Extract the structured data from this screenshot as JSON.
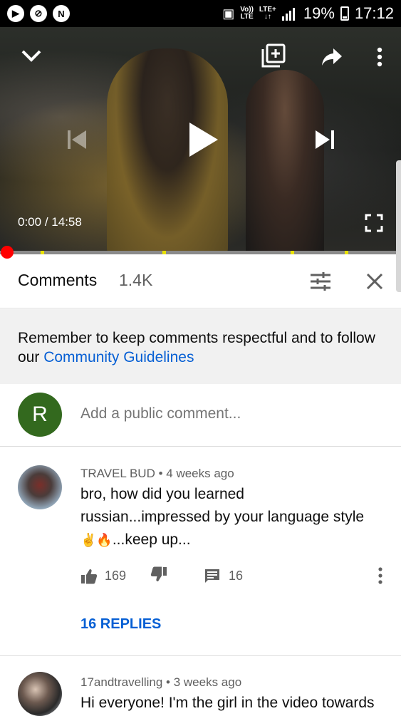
{
  "status_bar": {
    "network_top": "Vo))",
    "network_bottom": "LTE",
    "lte_top": "LTE+",
    "lte_bottom": "↓↑",
    "battery": "19%",
    "time": "17:12"
  },
  "player": {
    "time_current": "0:00",
    "time_separator": "/",
    "time_total": "14:58"
  },
  "comments_header": {
    "title": "Comments",
    "count": "1.4K"
  },
  "notice": {
    "text": "Remember to keep comments respectful and to follow our ",
    "link": "Community Guidelines"
  },
  "add_comment": {
    "avatar_letter": "R",
    "placeholder": "Add a public comment..."
  },
  "comments": [
    {
      "author": "TRAVEL BUD",
      "time": "4 weeks ago",
      "line1": "bro, how did you learned",
      "line2": "russian...impressed by your language style",
      "line3_emoji": "✌️🔥",
      "line3": "...keep up...",
      "likes": "169",
      "reply_count": "16",
      "replies_label": "16 REPLIES"
    },
    {
      "author": "17andtravelling",
      "time": "3 weeks ago",
      "line1": "Hi everyone! I'm the girl in the video towards"
    }
  ],
  "colors": {
    "accent_link": "#065fd4",
    "avatar_r": "#33691e",
    "progress_scrub": "#ff0000",
    "ad_marker": "#e8e100"
  }
}
